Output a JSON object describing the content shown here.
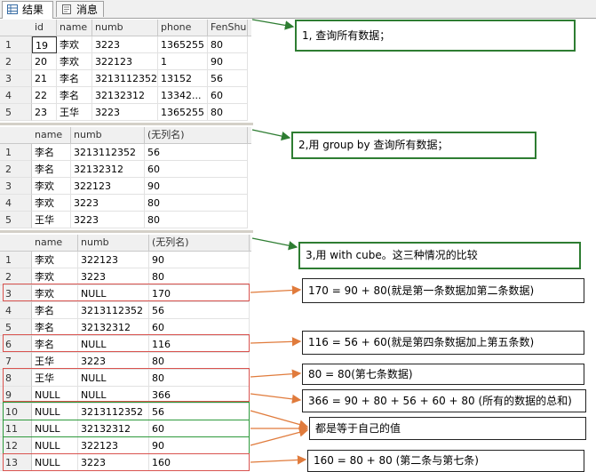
{
  "tabs": [
    {
      "label": "结果",
      "icon": "grid-icon",
      "active": true
    },
    {
      "label": "消息",
      "icon": "message-icon",
      "active": false
    }
  ],
  "grid1": {
    "columns": [
      "id",
      "name",
      "numb",
      "phone",
      "FenShu"
    ],
    "rows": [
      [
        "1",
        "19",
        "李欢",
        "3223",
        "1365255",
        "80"
      ],
      [
        "2",
        "20",
        "李欢",
        "322123",
        "1",
        "90"
      ],
      [
        "3",
        "21",
        "李名",
        "3213112352",
        "13152",
        "56"
      ],
      [
        "4",
        "22",
        "李名",
        "32132312",
        "13342...",
        "60"
      ],
      [
        "5",
        "23",
        "王华",
        "3223",
        "1365255",
        "80"
      ]
    ]
  },
  "grid2": {
    "columns": [
      "name",
      "numb",
      "(无列名)"
    ],
    "rows": [
      [
        "1",
        "李名",
        "3213112352",
        "56"
      ],
      [
        "2",
        "李名",
        "32132312",
        "60"
      ],
      [
        "3",
        "李欢",
        "322123",
        "90"
      ],
      [
        "4",
        "李欢",
        "3223",
        "80"
      ],
      [
        "5",
        "王华",
        "3223",
        "80"
      ]
    ]
  },
  "grid3": {
    "columns": [
      "name",
      "numb",
      "(无列名)"
    ],
    "rows": [
      [
        "1",
        "李欢",
        "322123",
        "90"
      ],
      [
        "2",
        "李欢",
        "3223",
        "80"
      ],
      [
        "3",
        "李欢",
        "NULL",
        "170"
      ],
      [
        "4",
        "李名",
        "3213112352",
        "56"
      ],
      [
        "5",
        "李名",
        "32132312",
        "60"
      ],
      [
        "6",
        "李名",
        "NULL",
        "116"
      ],
      [
        "7",
        "王华",
        "3223",
        "80"
      ],
      [
        "8",
        "王华",
        "NULL",
        "80"
      ],
      [
        "9",
        "NULL",
        "NULL",
        "366"
      ],
      [
        "10",
        "NULL",
        "3213112352",
        "56"
      ],
      [
        "11",
        "NULL",
        "32132312",
        "60"
      ],
      [
        "12",
        "NULL",
        "322123",
        "90"
      ],
      [
        "13",
        "NULL",
        "3223",
        "160"
      ]
    ]
  },
  "annotations": {
    "a1": "1, 查询所有数据；",
    "a2": "2,用 group by 查询所有数据；",
    "a3": "3,用 with cube。这三种情况的比较",
    "a4": "170 = 90 + 80(就是第一条数据加第二条数据)",
    "a5": "116 = 56 + 60(就是第四条数据加上第五条数)",
    "a6": "80 = 80(第七条数据)",
    "a7": "366 = 90 + 80 + 56 + 60 + 80 (所有的数据的总和)",
    "a8": "都是等于自己的值",
    "a9": "160 = 80 + 80 (第二条与第七条)"
  },
  "colors": {
    "green_box": "#2e7d32",
    "red_highlight": "#d9534f",
    "orange_arrow": "#e07b3c"
  }
}
